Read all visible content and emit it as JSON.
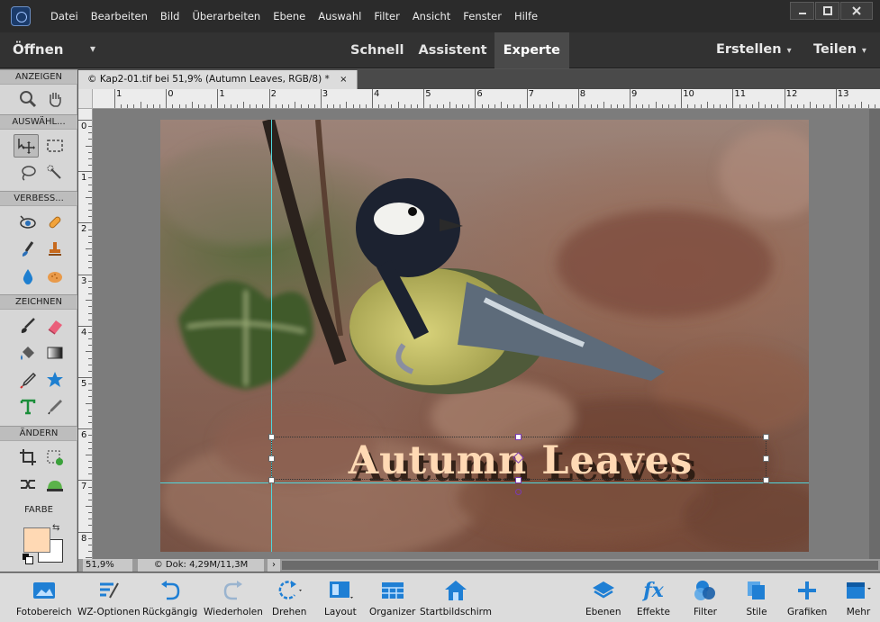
{
  "menu": [
    "Datei",
    "Bearbeiten",
    "Bild",
    "Überarbeiten",
    "Ebene",
    "Auswahl",
    "Filter",
    "Ansicht",
    "Fenster",
    "Hilfe"
  ],
  "modebar": {
    "open_label": "Öffnen",
    "tabs": [
      "Schnell",
      "Assistent",
      "Experte"
    ],
    "active_tab": "Experte",
    "create_label": "Erstellen",
    "share_label": "Teilen"
  },
  "tools": {
    "sections": [
      "ANZEIGEN",
      "AUSWÄHL...",
      "VERBESS...",
      "ZEICHNEN",
      "ÄNDERN"
    ],
    "color_label": "FARBE",
    "foreground_color": "#ffd9b4",
    "background_color": "#ffffff"
  },
  "document": {
    "tab_label": "© Kap2-01.tif bei 51,9% (Autumn Leaves, RGB/8) *",
    "close_label": "×",
    "text_layer": "Autumn Leaves"
  },
  "rulers": {
    "h_labels": [
      "1",
      "0",
      "1",
      "2",
      "3",
      "4",
      "5",
      "6",
      "7",
      "8",
      "9",
      "10",
      "11",
      "12",
      "13"
    ],
    "v_labels": [
      "0",
      "1",
      "2",
      "3",
      "4",
      "5",
      "6",
      "7",
      "8"
    ]
  },
  "status": {
    "zoom": "51,9%",
    "doc_info": "© Dok: 4,29M/11,3M",
    "arrow": "›"
  },
  "bottombar": [
    "Fotobereich",
    "WZ-Optionen",
    "Rückgängig",
    "Wiederholen",
    "Drehen",
    "Layout",
    "Organizer",
    "Startbildschirm",
    "Ebenen",
    "Effekte",
    "Filter",
    "Stile",
    "Grafiken",
    "Mehr"
  ]
}
